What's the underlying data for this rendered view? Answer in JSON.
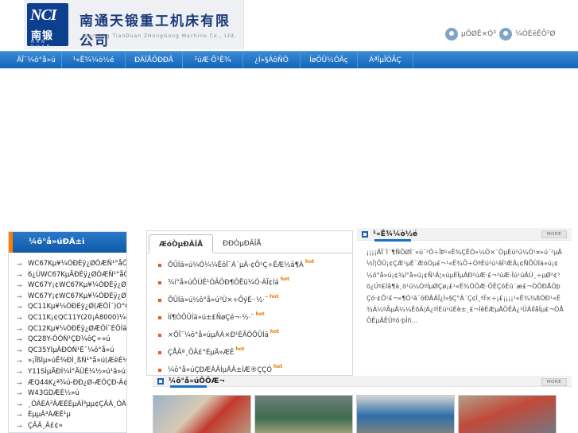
{
  "header": {
    "logo_mark_text": "NCI",
    "logo_mark_cn": "南锻",
    "logo_mark_py": "NAN DUAN",
    "company_name": "南通天锻重工机床有限公司",
    "company_name_en": "Nantong TianDuan ZHongGong Machine Co., Ltd.",
    "top_links": [
      {
        "label": "µ­ÖØÊ×Ò³",
        "icon": "home-icon"
      },
      {
        "label": "¼ÓÈëÊÕ²Ø",
        "icon": "bookmark-icon"
      }
    ]
  },
  "nav": {
    "items": [
      {
        "label": "ÄÏ¨¼ô°å»ú"
      },
      {
        "label": "¹«Ë¾¼ò½é"
      },
      {
        "label": "ÐÂÎÅÖÐÐÄ"
      },
      {
        "label": "²úÆ·Õ¹Ê¾"
      },
      {
        "label": "¿Í»§ÁôÑÔ"
      },
      {
        "label": "ÍøÕÛ½ÓÂç"
      },
      {
        "label": "ÁªÏµÎÒÃÇ"
      }
    ]
  },
  "sidebar": {
    "title": "¼ô°å»úÐÂ±ì",
    "items": [
      {
        "label": "WC67Kµ¥¼ÓÐÉÿ¿ØÖÆÑ¹°åÕÛÍä»ú"
      },
      {
        "label": "6¿ÚWC67KµÄÐÉÿ¿ØÖÆÑ¹°åÕÛÍä»ú"
      },
      {
        "label": "WC67Y¡¢WC67Kµ¥¼ÓÐÉÿ¿Ø(ÆÕÍ¨)Ó°ÕÛÍä»ú"
      },
      {
        "label": "WC67Y¡¢WC67Kµ¥¼ÓÐÉÿ¿Ø(ÆÕÍ¨)Ó°ÕÛÍä»ú"
      },
      {
        "label": "QC11Kµ¥¼ÓÐÉÿ¿Ø(ÆÕÍ¨)Ó°ÕÛÍä»ú"
      },
      {
        "label": "QC11K¡¢QC11Y(20¡Á8000)¼ôÂ"
      },
      {
        "label": "QC12Kµ¥¼ÓÐÉÿ¿ØÆÕÍ¨ÉÔÍä»ú"
      },
      {
        "label": "QC28Y-ÖÕÑ¹ÇÐ¼ôÇ÷»ú"
      },
      {
        "label": "QC35YÍµÄÐÓÑ¹Ê¯¼ô°å»ú"
      },
      {
        "label": "»¡ÏßÌµ»úË¾ÐÍ¸ßÑ¹°å»ú(ÆëÉ½"
      },
      {
        "label": "Y11SÌµÄÐÍ¼Ì°ÄÜÈ¼½»ú¹â»ú»ú"
      },
      {
        "label": "ÆQ44K¿ª¾ú-ÐÐ¿Ø-ÆÕÇÐ-Ã¢±ÊµÄÚ"
      },
      {
        "label": "W43GDÆÈ½»ú"
      },
      {
        "label": "¸ÖÃÈÁ³ÂÆÈÉµÀÎ³µµ¢ÇÂÃ¸ÖÃ£¢ÇÂ"
      },
      {
        "label": "ÈµµÂ³ÀÆÊ¹µ"
      },
      {
        "label": "ÇÂÃ¸Ã£¢»"
      }
    ]
  },
  "news": {
    "tabs": [
      {
        "label": "ÆóÒµÐÂÎÅ",
        "active": true
      },
      {
        "label": "ÐÐÒµÐÂÎÅ",
        "active": false
      }
    ],
    "hot_label": "hot",
    "items": [
      {
        "title": "ÕÛÍä»ú¼Ó¼¼ÊõÏ¨À´µÂ·¢Õ¹Ç÷ÊÆ½â¶Á"
      },
      {
        "title": "¾í°å»úÔÚÊ¹ÓÃÖÐ¶ÔËü¼Ó·ÀÏ¢Ìá"
      },
      {
        "title": "ÕÛÍä»ú½ô°å»ú²Ù×÷ÕýÈ··½·¨"
      },
      {
        "title": "Ìí¶ÓÕÛÍä»ú±£ÑøÇé¬·½·¨"
      },
      {
        "title": "×ÔÏ¯¼ô°å»úµÄÀ×Ð¹ÈÃÔÕÛÍä"
      },
      {
        "title": "ÇÅÂº¸ÖÂ£°ÉµÄ»ÆÊ"
      },
      {
        "title": "¼ô°å»úÇÐÆÂÄÍµÄÂ±ÌÆ®ÇÇÓ"
      }
    ]
  },
  "about": {
    "title": "¹«Ë¾¼ò½é",
    "more_label": "MORE",
    "text": "¡¡¡¡ÄÏ¨Ì¨¶ÑÖØÌ¨»ú´²Ó÷ÏÞ¹«Ë¾ÇÊÒ»¼Ò×¨ÒµÉú²ú¼Ó¹¤»ú´²µÄ½Ï¦ÕÛ¡¢ÇÆ¹µÉ¨ÆóÒµ£¬¹«Ë¾Ö÷ÒªÉú²ú¹âÎ³ÆÂ¡¢ÑÕÛÍä»ú¡¢¼ô°å»ú¡¢¾í°å»ú¡¢Ñ¹Á¦»úµÈÏµÁÐ²úÆ·£¬²úÆ·Ïú¹úÄÚ¸÷µØ²¢³ö¿Úº£Íâ¶à¸ö¹ú¼ÒºÍµØÇø¡£¹«Ë¾ÒÔÆ·ÖÊÇóÉú´æ£¬ÒÔÐÅÓþÇó·¢Õ¹£¬»¶Ó­¹ã´óÐÂÀÏ¿Í»§Ç°À´Ç¢Ì¸ºÏ×÷¡£¡¡¡¡¹«Ë¾¾ßÓÐ¹«Ë¾Á¼ºÃµÄ¼¼ÊõÁ¦Á¿ºÍÉú²úÉè±¸£¬ÍêÉÆµÄÖÊÁ¿¹ÜÀíÌåÏµ£¬ÓÅÖÊµÄÊÛºó·þÎñ..."
  },
  "products": {
    "title": "¼ô°å»úÕÕÆ¬",
    "more_label": "MORE",
    "items": [
      {
        "name": "shear-machine-photo-1"
      },
      {
        "name": "shear-machine-photo-2"
      },
      {
        "name": "shear-machine-photo-3"
      },
      {
        "name": "shear-machine-photo-4"
      }
    ]
  }
}
